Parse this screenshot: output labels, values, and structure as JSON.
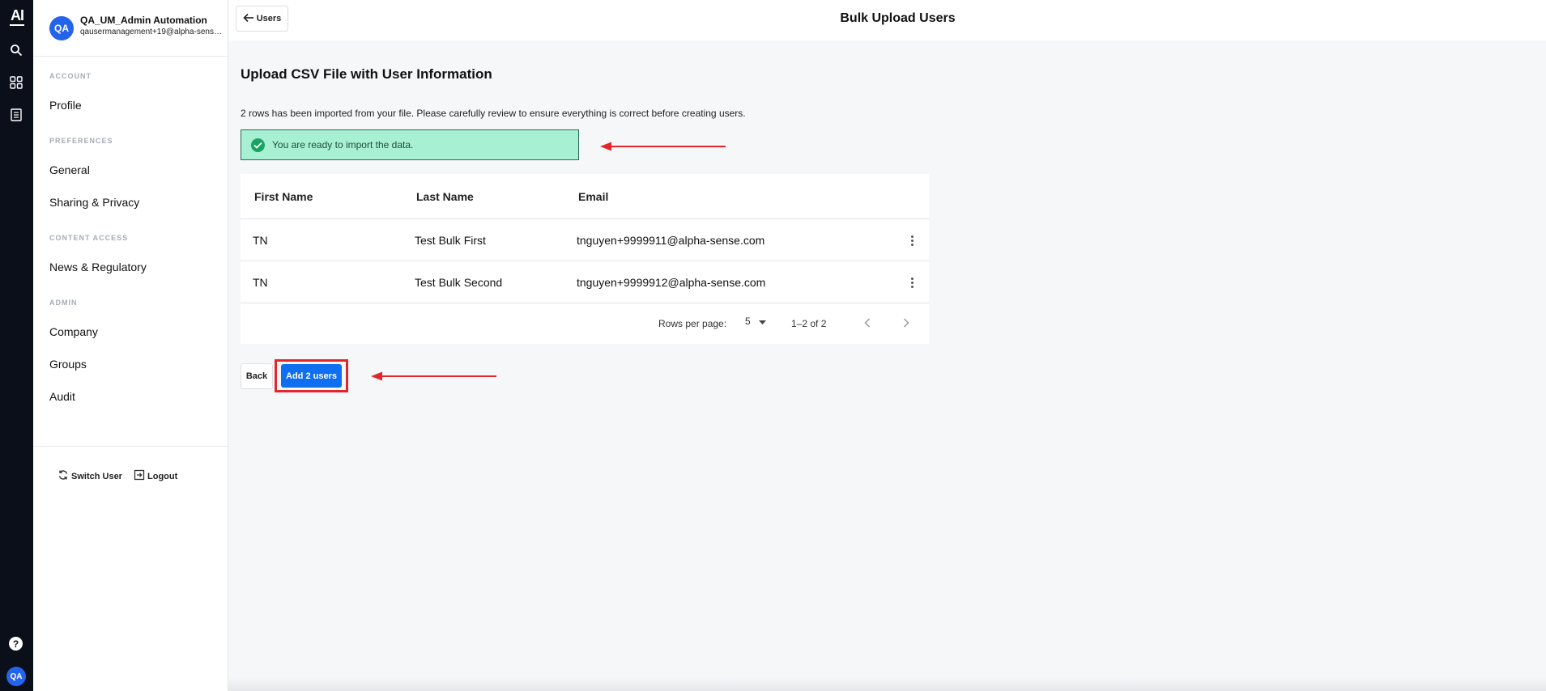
{
  "rail": {
    "logo": "AI",
    "icons": [
      "search-icon",
      "grid-icon",
      "document-icon"
    ],
    "help": "?",
    "avatar": "QA"
  },
  "user": {
    "initials": "QA",
    "name": "QA_UM_Admin Automation",
    "email": "qausermanagement+19@alpha-sense.com"
  },
  "sidebar": {
    "sections": [
      {
        "label": "ACCOUNT",
        "items": [
          "Profile"
        ]
      },
      {
        "label": "PREFERENCES",
        "items": [
          "General",
          "Sharing & Privacy"
        ]
      },
      {
        "label": "CONTENT ACCESS",
        "items": [
          "News & Regulatory"
        ]
      },
      {
        "label": "ADMIN",
        "items": [
          "Company",
          "Groups",
          "Audit"
        ]
      }
    ],
    "switch_user": "Switch User",
    "logout": "Logout"
  },
  "header": {
    "back_label": "Users",
    "title": "Bulk Upload Users"
  },
  "main": {
    "title": "Upload CSV File with User Information",
    "info": "2 rows has been imported from your file. Please carefully review to ensure everything is correct before creating users.",
    "success_message": "You are ready to import the data.",
    "success_color": "#a7f0d3",
    "table": {
      "columns": [
        "First Name",
        "Last Name",
        "Email"
      ],
      "rows": [
        {
          "first": "TN",
          "last": "Test Bulk First",
          "email": "tnguyen+9999911@alpha-sense.com"
        },
        {
          "first": "TN",
          "last": "Test Bulk Second",
          "email": "tnguyen+9999912@alpha-sense.com"
        }
      ],
      "rows_per_page_label": "Rows per page:",
      "rows_per_page_value": "5",
      "range": "1–2 of 2"
    },
    "back_button": "Back",
    "add_button": "Add 2 users",
    "accent_color": "#0f6ff0",
    "annotation_color": "#e3262b"
  }
}
